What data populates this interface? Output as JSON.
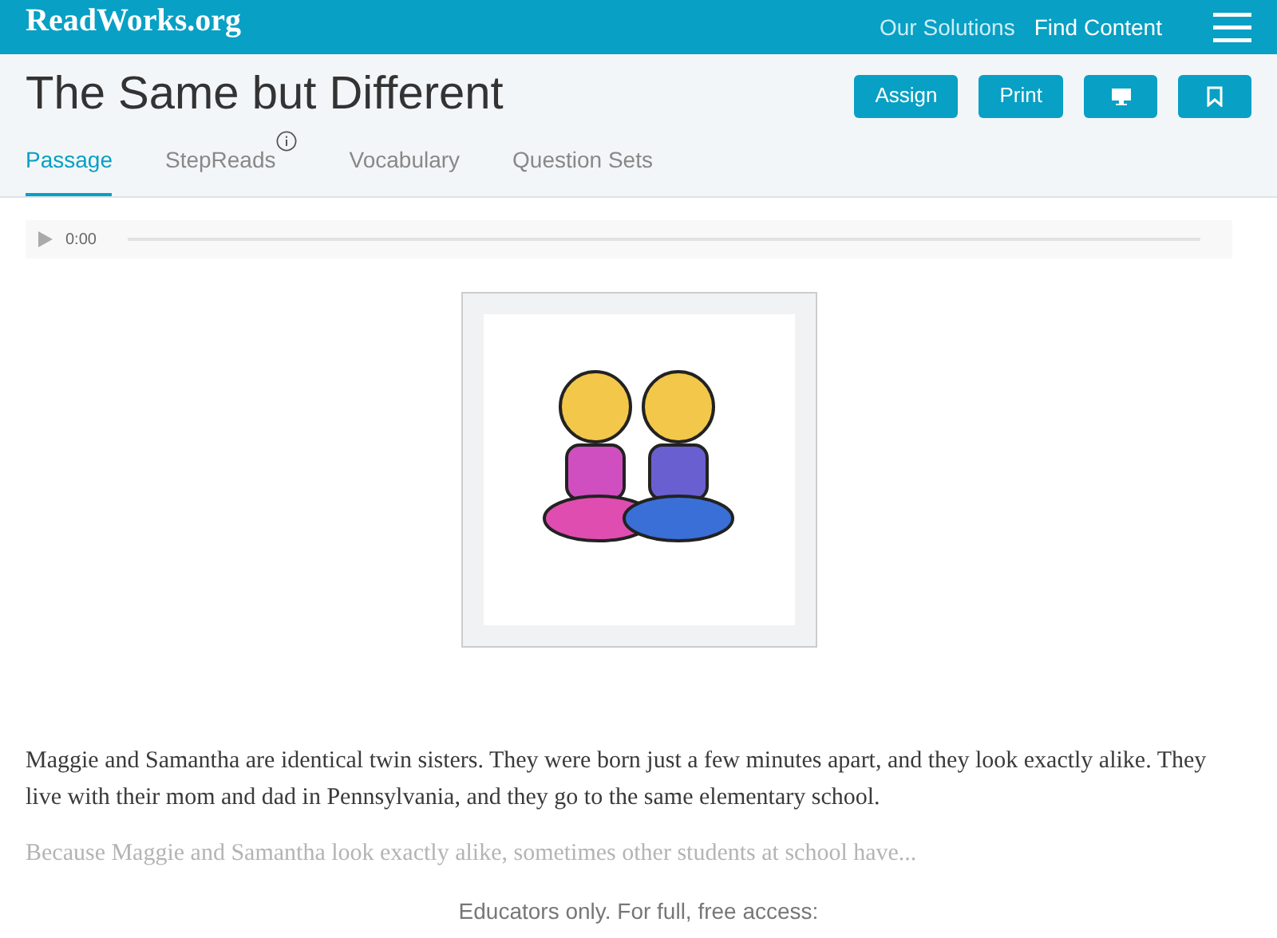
{
  "header": {
    "logo": "ReadWorks.org",
    "nav": [
      "Our Solutions",
      "Find Content"
    ]
  },
  "title": "The Same but Different",
  "actions": [
    {
      "kind": "text",
      "label": "Assign"
    },
    {
      "kind": "text",
      "label": "Print"
    },
    {
      "kind": "monitor"
    },
    {
      "kind": "bookmark"
    }
  ],
  "tabs": [
    {
      "label": "Passage",
      "selected": true,
      "info": false
    },
    {
      "label": "StepReads",
      "selected": false,
      "info": true
    },
    {
      "label": "Vocabulary",
      "selected": false,
      "info": false
    },
    {
      "label": "Question Sets",
      "selected": false,
      "info": false
    }
  ],
  "audio": {
    "time": "0:00"
  },
  "passage": [
    {
      "text": "Maggie and Samantha are identical twin sisters. They were born just a few minutes apart, and they look exactly alike. They live with their mom and dad in Pennsylvania, and they go to the same elementary school.",
      "faded": false
    },
    {
      "text": "Because Maggie and Samantha look exactly alike, sometimes other students at school have...",
      "faded": true
    }
  ],
  "access_note": "Educators only. For full, free access:"
}
